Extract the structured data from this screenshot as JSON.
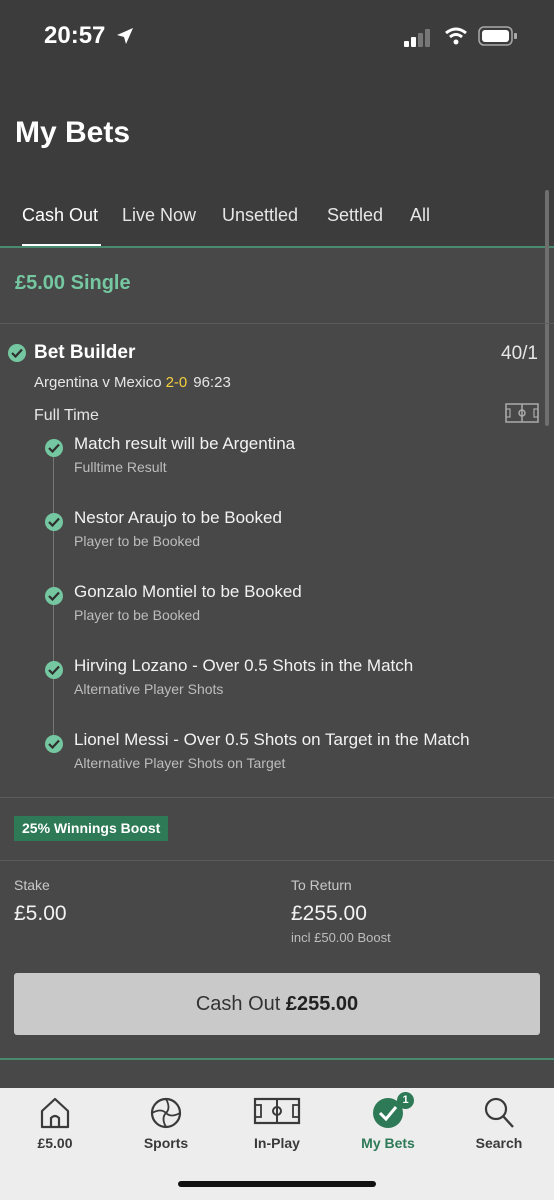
{
  "status_bar": {
    "time": "20:57"
  },
  "header": {
    "title": "My Bets"
  },
  "tabs": [
    {
      "label": "Cash Out",
      "active": true
    },
    {
      "label": "Live Now"
    },
    {
      "label": "Unsettled"
    },
    {
      "label": "Settled"
    },
    {
      "label": "All"
    }
  ],
  "bet": {
    "heading": "£5.00 Single",
    "type": "Bet Builder",
    "odds": "40/1",
    "match": "Argentina v Mexico",
    "score": "2-0",
    "clock": "96:23",
    "period": "Full Time",
    "legs": [
      {
        "title": "Match result will be Argentina",
        "market": "Fulltime Result"
      },
      {
        "title": "Nestor Araujo to be Booked",
        "market": "Player to be Booked"
      },
      {
        "title": "Gonzalo Montiel to be Booked",
        "market": "Player to be Booked"
      },
      {
        "title": "Hirving Lozano - Over 0.5 Shots in the Match",
        "market": "Alternative Player Shots"
      },
      {
        "title": "Lionel Messi - Over 0.5 Shots on Target in the Match",
        "market": "Alternative Player Shots on Target"
      }
    ],
    "boost_badge": "25% Winnings Boost",
    "stake_label": "Stake",
    "stake": "£5.00",
    "return_label": "To Return",
    "return": "£255.00",
    "return_note": "incl £50.00 Boost",
    "cashout_label": "Cash Out",
    "cashout_value": "£255.00"
  },
  "bottom_nav": [
    {
      "label": "£5.00",
      "icon": "home-icon"
    },
    {
      "label": "Sports",
      "icon": "football-icon"
    },
    {
      "label": "In-Play",
      "icon": "pitch-icon"
    },
    {
      "label": "My Bets",
      "icon": "check-circle-icon",
      "badge": "1",
      "active": true
    },
    {
      "label": "Search",
      "icon": "search-icon"
    }
  ],
  "colors": {
    "accent": "#74c7a0",
    "brand_green": "#2e7a57",
    "score": "#f3d03e"
  }
}
